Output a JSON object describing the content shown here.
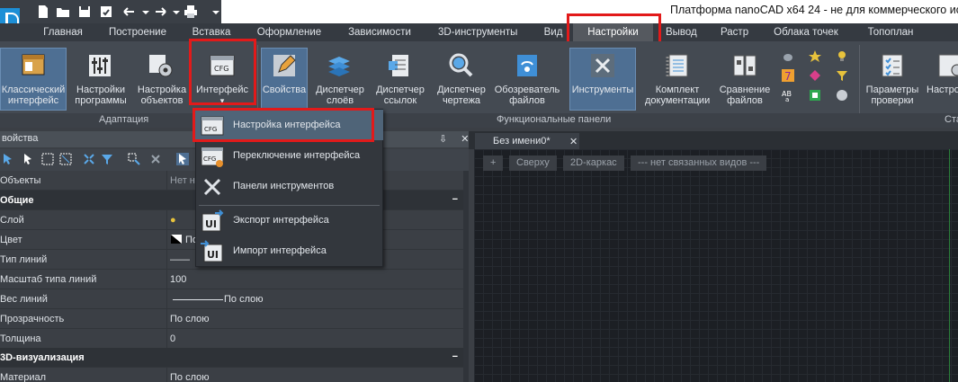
{
  "app": {
    "title": "Платформа nanoCAD x64 24 - не для коммерческого испо"
  },
  "quick_access": [
    "new-file-icon",
    "open-folder-icon",
    "save-icon",
    "save-as-icon",
    "save-check-icon",
    "undo-icon",
    "dropdown-arrow-icon",
    "redo-icon",
    "dropdown-arrow-icon",
    "print-icon",
    "more-icon"
  ],
  "tabs": [
    "Главная",
    "Построение",
    "Вставка",
    "Оформление",
    "Зависимости",
    "3D-инструменты",
    "Вид",
    "Настройки",
    "Вывод",
    "Растр",
    "Облака точек",
    "Топоплан"
  ],
  "active_tab": "Настройки",
  "ribbon": {
    "buttons": [
      {
        "line1": "Классический",
        "line2": "интерфейс",
        "icon": "classic-interface-icon"
      },
      {
        "line1": "Настройки",
        "line2": "программы",
        "icon": "program-settings-icon"
      },
      {
        "line1": "Настройка",
        "line2": "объектов",
        "icon": "object-settings-icon"
      },
      {
        "line1": "Интерфейс",
        "line2": "▾",
        "icon": "cfg-interface-icon"
      },
      {
        "line1": "Свойства",
        "line2": "",
        "icon": "properties-icon"
      },
      {
        "line1": "Диспетчер",
        "line2": "слоёв",
        "icon": "layers-manager-icon"
      },
      {
        "line1": "Диспетчер",
        "line2": "ссылок",
        "icon": "references-manager-icon"
      },
      {
        "line1": "Диспетчер",
        "line2": "чертежа",
        "icon": "drawing-manager-icon"
      },
      {
        "line1": "Обозреватель",
        "line2": "файлов",
        "icon": "file-explorer-icon"
      },
      {
        "line1": "Инструменты",
        "line2": "",
        "icon": "tools-icon"
      },
      {
        "line1": "Комплект",
        "line2": "документации",
        "icon": "documentation-set-icon"
      },
      {
        "line1": "Сравнение",
        "line2": "файлов",
        "icon": "file-compare-icon"
      },
      {
        "line1": "Параметры",
        "line2": "проверки",
        "icon": "check-params-icon"
      },
      {
        "line1": "Настро",
        "line2": "",
        "icon": "settings-icon"
      }
    ],
    "groups": {
      "adaptation": "Адаптация",
      "functional": "Функциональные панели",
      "standards": "Ста"
    }
  },
  "properties": {
    "title": "войства",
    "pin": "⇩ ✕",
    "rows": [
      {
        "key": "Объекты",
        "value": "Нет н",
        "header": false
      },
      {
        "key": "Общие",
        "value": "",
        "header": true
      },
      {
        "key": "Слой",
        "value": "",
        "header": false
      },
      {
        "key": "Цвет",
        "value": "По",
        "header": false
      },
      {
        "key": "Тип линий",
        "value": "——",
        "header": false
      },
      {
        "key": "Масштаб типа линий",
        "value": "100",
        "header": false
      },
      {
        "key": "Вес линий",
        "value": "По слою",
        "header": false
      },
      {
        "key": "Прозрачность",
        "value": "По слою",
        "header": false
      },
      {
        "key": "Толщина",
        "value": "0",
        "header": false
      },
      {
        "key": "3D-визуализация",
        "value": "",
        "header": true
      },
      {
        "key": "Материал",
        "value": "По слою",
        "header": false
      }
    ]
  },
  "drawing": {
    "doc_tab": "Без имени0*",
    "controls": [
      "+",
      "Сверху",
      "2D-каркас",
      "--- нет связанных видов ---"
    ]
  },
  "menu": {
    "items": [
      {
        "label": "Настройка интерфейса",
        "icon": "cfg-settings-icon"
      },
      {
        "label": "Переключение интерфейса",
        "icon": "cfg-switch-icon"
      },
      {
        "label": "Панели инструментов",
        "icon": "toolbars-icon"
      },
      {
        "label": "Экспорт интерфейса",
        "icon": "ui-export-icon"
      },
      {
        "label": "Импорт интерфейса",
        "icon": "ui-import-icon"
      }
    ]
  },
  "colors": {
    "accent": "#4e6f93",
    "highlight": "#e21a1a",
    "drawing_bg": "#1c1f24"
  }
}
